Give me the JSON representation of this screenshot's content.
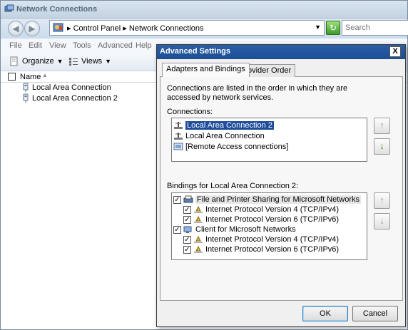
{
  "explorer": {
    "title": "Network Connections",
    "address": {
      "path": [
        "Control Panel",
        "Network Connections"
      ],
      "separator": "▸"
    },
    "search_placeholder": "Search",
    "menu": [
      "File",
      "Edit",
      "View",
      "Tools",
      "Advanced",
      "Help"
    ],
    "toolbar": {
      "organize_label": "Organize",
      "views_label": "Views"
    },
    "columns": {
      "name_label": "Name"
    },
    "items": [
      {
        "label": "Local Area Connection",
        "icon": "network-adapter-icon"
      },
      {
        "label": "Local Area Connection 2",
        "icon": "network-adapter-icon"
      }
    ]
  },
  "dialog": {
    "title": "Advanced Settings",
    "close_label": "X",
    "tabs": [
      {
        "label": "Adapters and Bindings",
        "active": true
      },
      {
        "label": "Provider Order",
        "active": false
      }
    ],
    "description": "Connections are listed in the order in which they are accessed by network services.",
    "connections_label": "Connections:",
    "connections": [
      {
        "label": "Local Area Connection 2",
        "selected": true,
        "icon": "network-connection-icon"
      },
      {
        "label": "Local Area Connection",
        "selected": false,
        "icon": "network-connection-icon"
      },
      {
        "label": "[Remote Access connections]",
        "selected": false,
        "icon": "remote-access-icon"
      }
    ],
    "bindings_label": "Bindings for Local Area Connection 2:",
    "bindings": [
      {
        "label": "File and Printer Sharing for Microsoft Networks",
        "checked": true,
        "indent": 0,
        "icon": "file-printer-sharing-icon",
        "highlight": true
      },
      {
        "label": "Internet Protocol Version 4 (TCP/IPv4)",
        "checked": true,
        "indent": 1,
        "icon": "protocol-icon"
      },
      {
        "label": "Internet Protocol Version 6 (TCP/IPv6)",
        "checked": true,
        "indent": 1,
        "icon": "protocol-icon"
      },
      {
        "label": "Client for Microsoft Networks",
        "checked": true,
        "indent": 0,
        "icon": "network-client-icon"
      },
      {
        "label": "Internet Protocol Version 4 (TCP/IPv4)",
        "checked": true,
        "indent": 1,
        "icon": "protocol-icon"
      },
      {
        "label": "Internet Protocol Version 6 (TCP/IPv6)",
        "checked": true,
        "indent": 1,
        "icon": "protocol-icon"
      }
    ],
    "ok_label": "OK",
    "cancel_label": "Cancel"
  },
  "colors": {
    "dialog_title_bg": "#1c4e94",
    "selection_bg": "#1f4d9b",
    "move_down_green": "#2d8a1d"
  }
}
